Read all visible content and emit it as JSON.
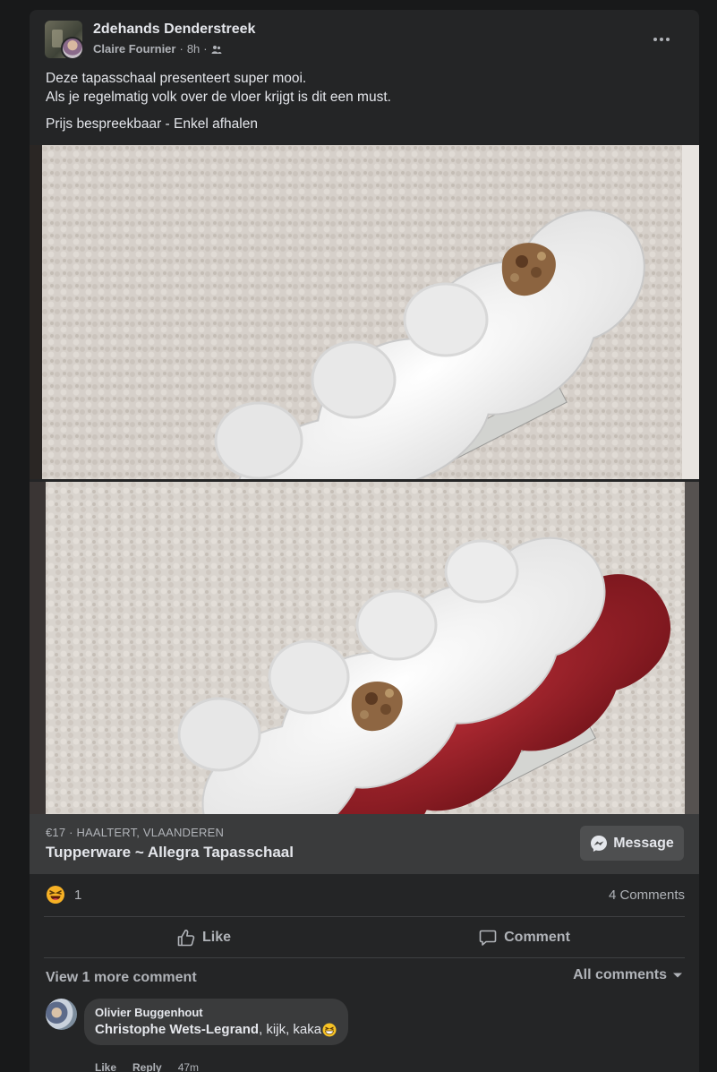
{
  "post": {
    "group_name": "2dehands Denderstreek",
    "author": "Claire Fournier",
    "time": "8h",
    "more_icon": "more-horizontal-icon",
    "privacy_icon": "members-icon",
    "text_line1": "Deze tapasschaal presenteert super mooi.",
    "text_line2": "Als je regelmatig volk over de vloer krijgt is dit een must.",
    "text_line3": "Prijs bespreekbaar - Enkel afhalen"
  },
  "listing": {
    "price_location": "€17 · HAALTERT, VLAANDEREN",
    "title": "Tupperware ~ Allegra Tapasschaal",
    "message_label": "Message",
    "message_icon": "messenger-icon"
  },
  "reactions": {
    "emoji": "laughing-face-icon",
    "count": "1",
    "comments_count": "4 Comments"
  },
  "actions": {
    "like_label": "Like",
    "comment_label": "Comment"
  },
  "comments_nav": {
    "view_more": "View 1 more comment",
    "all_comments": "All comments"
  },
  "comment": {
    "author": "Olivier Buggenhout",
    "mention": "Christophe Wets-Legrand",
    "text": ", kijk, kaka",
    "like": "Like",
    "reply": "Reply",
    "time": "47m"
  },
  "colors": {
    "background": "#18191a",
    "card": "#242526",
    "listing_bar": "#3a3b3c",
    "text_primary": "#e4e6eb",
    "text_secondary": "#b0b3b8",
    "bowl_red": "#8e1f26"
  }
}
